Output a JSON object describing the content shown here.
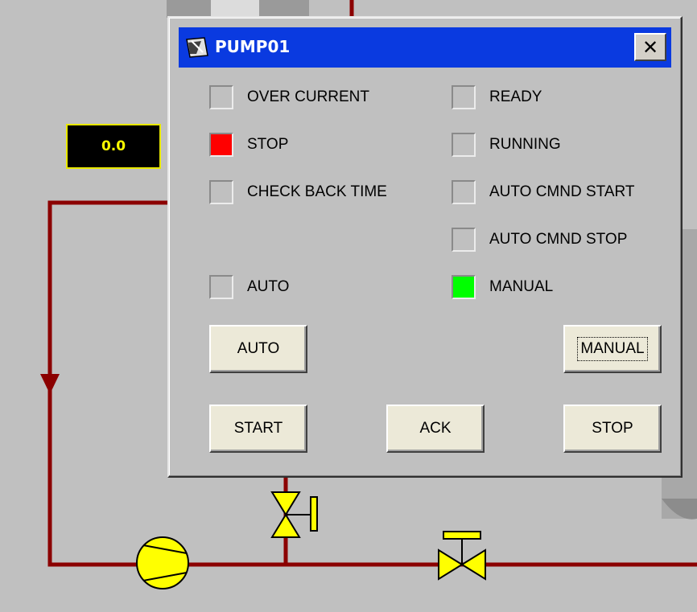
{
  "background": {
    "value_display": "0.0",
    "pipe_color": "#8b0000",
    "equipment_color": "#ffff00"
  },
  "window": {
    "title": "PUMP01",
    "close_label": "✕",
    "titlebar_color": "#0a3ae0"
  },
  "indicators": {
    "over_current": {
      "label": "OVER CURRENT",
      "state": "off"
    },
    "ready": {
      "label": "READY",
      "state": "off"
    },
    "stop": {
      "label": "STOP",
      "state": "on",
      "color": "#ff0000"
    },
    "running": {
      "label": "RUNNING",
      "state": "off"
    },
    "check_back_time": {
      "label": "CHECK BACK TIME",
      "state": "off"
    },
    "auto_cmnd_start": {
      "label": "AUTO CMND START",
      "state": "off"
    },
    "auto_cmnd_stop": {
      "label": "AUTO CMND STOP",
      "state": "off"
    },
    "auto": {
      "label": "AUTO",
      "state": "off"
    },
    "manual": {
      "label": "MANUAL",
      "state": "on",
      "color": "#00ff00"
    }
  },
  "buttons": {
    "auto": "AUTO",
    "manual": "MANUAL",
    "start": "START",
    "ack": "ACK",
    "stop": "STOP"
  }
}
